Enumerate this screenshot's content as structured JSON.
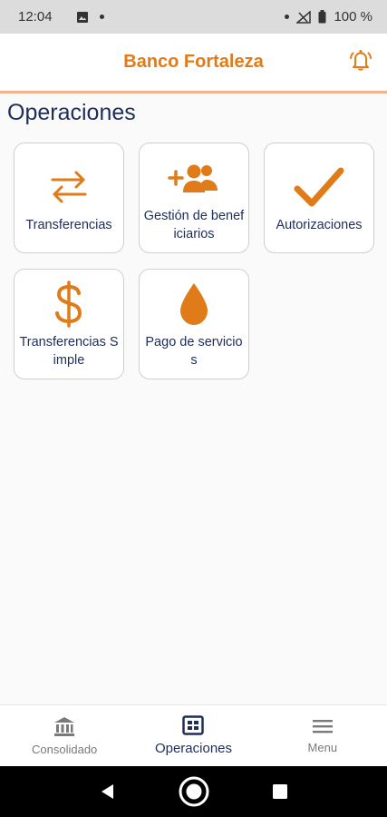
{
  "status_bar": {
    "time": "12:04",
    "battery": "100 %"
  },
  "header": {
    "title": "Banco Fortaleza",
    "bell_icon": "bell-ring-icon"
  },
  "main": {
    "title": "Operaciones",
    "tiles": [
      {
        "label": "Transferencias",
        "icon": "transfer-arrows-icon"
      },
      {
        "label": "Gestión de beneficiarios",
        "icon": "add-group-icon"
      },
      {
        "label": "Autorizaciones",
        "icon": "checkmark-icon"
      },
      {
        "label": "Transferencias Simple",
        "icon": "dollar-icon"
      },
      {
        "label": "Pago de servicios",
        "icon": "drop-icon"
      }
    ]
  },
  "bottom_nav": {
    "items": [
      {
        "label": "Consolidado",
        "icon": "bank-icon"
      },
      {
        "label": "Operaciones",
        "icon": "dashboard-icon",
        "active": true
      },
      {
        "label": "Menu",
        "icon": "hamburger-icon"
      }
    ]
  },
  "colors": {
    "accent": "#e07b1a",
    "navy": "#1e2d5a",
    "header_line": "#f0b38a"
  }
}
